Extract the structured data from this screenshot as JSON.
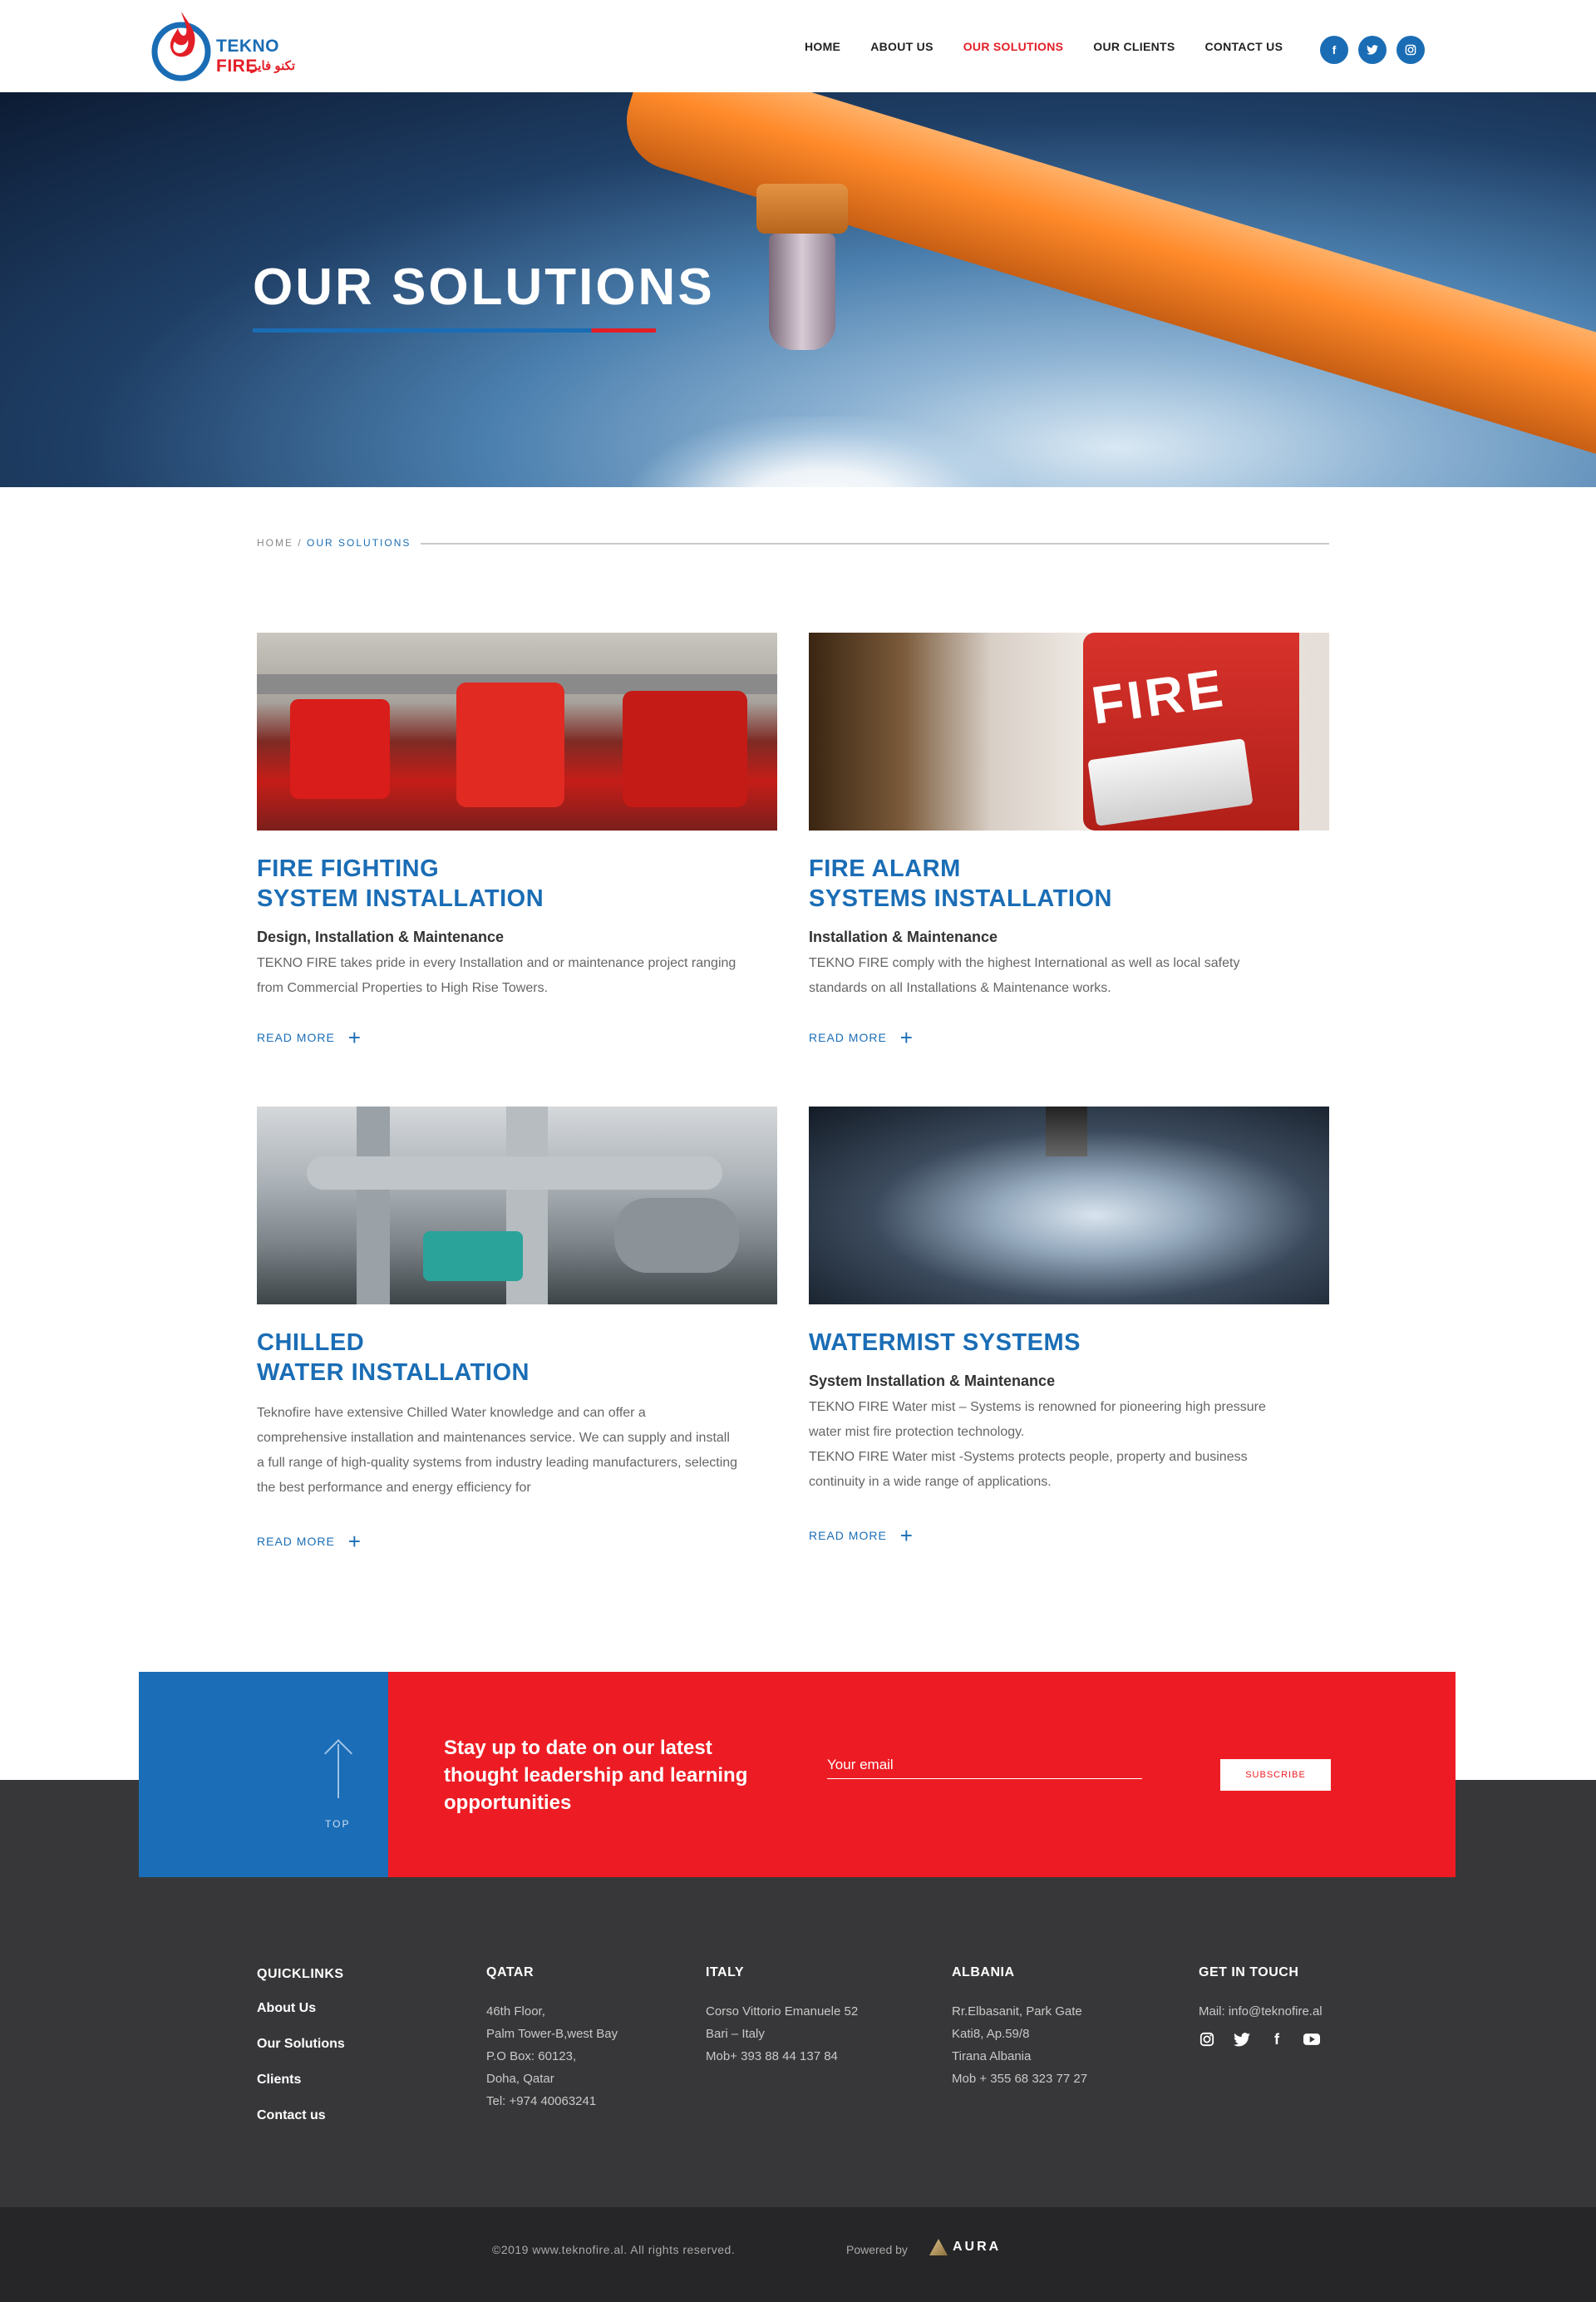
{
  "brand": {
    "name_part1": "TEKNO",
    "name_part2": "FIRE",
    "arabic": "تكنو فاير",
    "colors": {
      "blue": "#1a6db5",
      "red": "#ed1c24",
      "dark": "#373739"
    }
  },
  "nav": {
    "items": [
      {
        "label": "HOME"
      },
      {
        "label": "ABOUT US"
      },
      {
        "label": "OUR SOLUTIONS",
        "active": true
      },
      {
        "label": "OUR CLIENTS"
      },
      {
        "label": "CONTACT US"
      }
    ],
    "socials": [
      "facebook-icon",
      "twitter-icon",
      "instagram-icon"
    ]
  },
  "hero": {
    "title": "OUR SOLUTIONS"
  },
  "breadcrumb": {
    "home": "HOME /",
    "current": "OUR SOLUTIONS"
  },
  "solutions": [
    {
      "title_l1": "FIRE FIGHTING",
      "title_l2": "SYSTEM INSTALLATION",
      "subtitle": "Design, Installation & Maintenance",
      "body": "TEKNO FIRE takes pride in every Installation and or maintenance project ranging from Commercial Properties to High Rise Towers.",
      "more": "READ MORE"
    },
    {
      "title_l1": "FIRE ALARM",
      "title_l2": "SYSTEMS INSTALLATION",
      "subtitle": "Installation & Maintenance",
      "body": "TEKNO FIRE comply with the highest International as well as local safety standards on all Installations & Maintenance works.",
      "more": "READ MORE",
      "img_label": "FIRE"
    },
    {
      "title_l1": "CHILLED",
      "title_l2": "WATER INSTALLATION",
      "subtitle": "",
      "body": "Teknofire have extensive Chilled Water knowledge and can offer a comprehensive installation and maintenances service. We can supply and install a full range of high-quality systems from industry leading manufacturers, selecting the best performance and energy efficiency for",
      "more": "READ MORE"
    },
    {
      "title_l1": "WATERMIST SYSTEMS",
      "title_l2": "",
      "subtitle": "System Installation & Maintenance",
      "body": "TEKNO FIRE Water mist – Systems is renowned for pioneering high pressure water mist fire protection technology.",
      "body2": "TEKNO FIRE Water mist -Systems protects people, property and business continuity in a wide range of applications.",
      "more": "READ MORE"
    }
  ],
  "newsletter": {
    "top_label": "TOP",
    "text": "Stay up to date on our latest thought leadership and learning opportunities",
    "email_placeholder": "Your email",
    "subscribe": "SUBSCRIBE"
  },
  "footer": {
    "quicklinks": {
      "title": "QUICKLINKS",
      "items": [
        "About Us",
        "Our Solutions",
        "Clients",
        "Contact us"
      ]
    },
    "qatar": {
      "title": "QATAR",
      "lines": [
        "46th Floor,",
        "Palm Tower-B,west Bay",
        "P.O Box: 60123,",
        "Doha, Qatar",
        "Tel: +974 40063241"
      ]
    },
    "italy": {
      "title": "ITALY",
      "lines": [
        "Corso Vittorio Emanuele 52",
        "Bari – Italy",
        "Mob+ 393 88 44 137 84"
      ]
    },
    "albania": {
      "title": "ALBANIA",
      "lines": [
        "Rr.Elbasanit, Park Gate",
        "Kati8, Ap.59/8",
        "Tirana Albania",
        "Mob + 355 68 323 77 27"
      ]
    },
    "contact": {
      "title": "GET IN TOUCH",
      "email": "Mail: info@teknofire.al",
      "icons": [
        "instagram-icon",
        "twitter-icon",
        "facebook-icon",
        "youtube-icon"
      ]
    },
    "copyright": "©2019 www.teknofire.al. All rights reserved.",
    "powered_by": "Powered by",
    "powered_brand": "AURA"
  }
}
